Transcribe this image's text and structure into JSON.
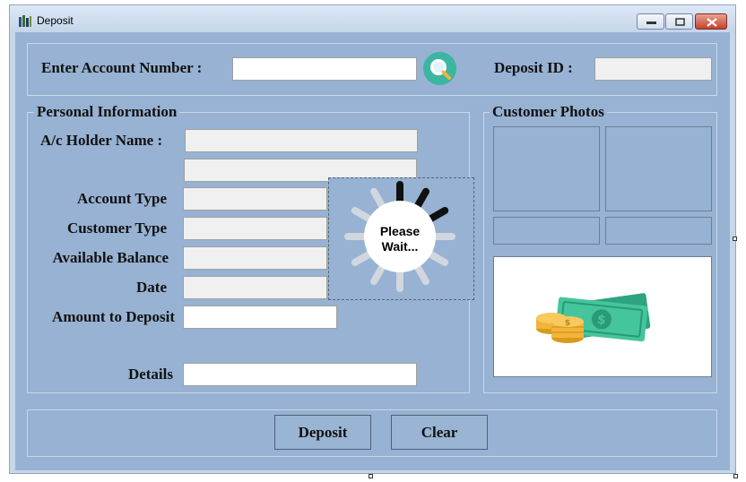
{
  "window": {
    "title": "Deposit"
  },
  "search": {
    "account_label": "Enter Account Number :",
    "account_value": "",
    "deposit_id_label": "Deposit ID :",
    "deposit_id_value": ""
  },
  "personal": {
    "legend": "Personal Information",
    "holder_label": "A/c Holder Name :",
    "account_type_label": "Account Type",
    "customer_type_label": "Customer Type",
    "balance_label": "Available Balance",
    "date_label": "Date",
    "amount_label": "Amount to Deposit",
    "details_label": "Details",
    "amount_value": "",
    "details_value": ""
  },
  "loading": {
    "line1": "Please",
    "line2": "Wait..."
  },
  "photos": {
    "legend": "Customer Photos"
  },
  "actions": {
    "deposit_label": "Deposit",
    "clear_label": "Clear"
  },
  "icons": {
    "search": "magnifier-icon",
    "app": "app-icon",
    "money": "money-stack-icon",
    "spinner": "spinner-icon"
  },
  "colors": {
    "client_bg": "#97b2d2",
    "search_button": "#3cb6a0",
    "spinner_active": "#111111",
    "spinner_inactive": "#d0d7df"
  }
}
